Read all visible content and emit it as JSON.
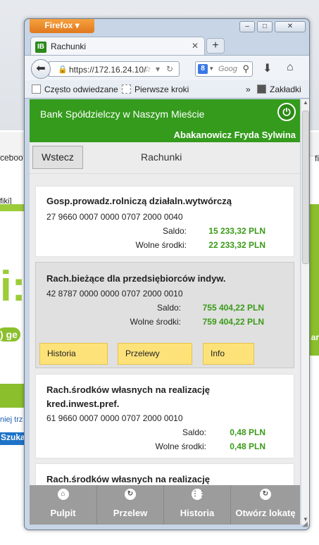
{
  "background": {
    "left_text": "ceboo",
    "left_text2": "fiki]",
    "right_text1": "fi",
    "right_text2": "ar",
    "big_text": "i:",
    "g_text": ") ge",
    "link_text": "niej trz",
    "search_text": "Szuka"
  },
  "browser": {
    "app_button": "Firefox",
    "minimize": "‒",
    "restore": "□",
    "close": "✕",
    "tab_icon": "IB",
    "tab_title": "Rachunki",
    "tab_close": "✕",
    "new_tab": "+",
    "url": "https://172.16.24.10/",
    "search_engine_icon": "8",
    "search_placeholder": "Goog",
    "bookmarks": [
      "Często odwiedzane",
      "Pierwsze kroki"
    ],
    "bookmarks_overflow": "»",
    "bookmarks_menu": "Zakładki",
    "accent": "#e0781d"
  },
  "app": {
    "bank_name": "Bank Spółdzielczy w Naszym Mieście",
    "user_name": "Abakanowicz Fryda Sylwina",
    "back_button": "Wstecz",
    "page_title": "Rachunki",
    "brand_color": "#349b1c",
    "saldo_label": "Saldo:",
    "wolne_label": "Wolne środki:",
    "accounts": [
      {
        "name": "Gosp.prowadz.rolniczą działaln.wytwórczą",
        "number": "27 9660 0007 0000 0707 2000 0040",
        "saldo": "15 233,32 PLN",
        "wolne": "22 233,32 PLN"
      },
      {
        "name": "Rach.bieżące dla przedsiębiorców indyw.",
        "number": "42 8787 0000 0000 0707 2000 0010",
        "saldo": "755 404,22 PLN",
        "wolne": "759 404,22 PLN",
        "actions": [
          "Historia",
          "Przelewy",
          "Info"
        ]
      },
      {
        "name": "Rach.środków własnych na realizację kred.inwest.pref.",
        "number": "61 9660 0007 0000 0707 2000 0010",
        "saldo": "0,48 PLN",
        "wolne": "0,48 PLN"
      },
      {
        "name": "Rach.środków własnych na realizację"
      }
    ],
    "bottom_nav": [
      {
        "label": "Pulpit",
        "icon": "home-icon",
        "glyph": "⌂"
      },
      {
        "label": "Przelew",
        "icon": "refresh-icon",
        "glyph": "↻"
      },
      {
        "label": "Historia",
        "icon": "grid-icon",
        "glyph": "⋮⋮"
      },
      {
        "label": "Otwórz lokatę",
        "icon": "refresh-icon",
        "glyph": "↻"
      }
    ]
  }
}
